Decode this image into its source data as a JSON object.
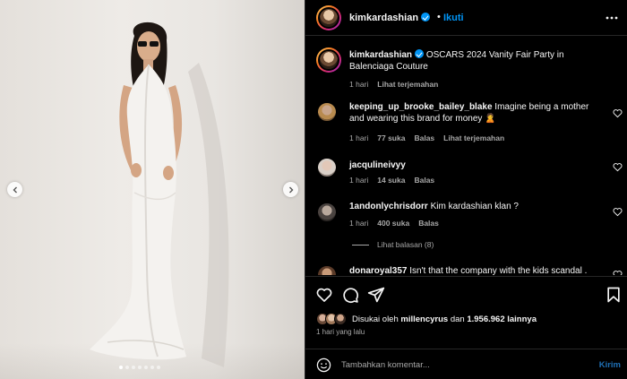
{
  "post": {
    "username": "kimkardashian",
    "verified": true,
    "separator": "•",
    "follow_label": "Ikuti",
    "caption": "OSCARS 2024 Vanity Fair Party in Balenciaga Couture",
    "caption_time": "1 hari",
    "caption_translate": "Lihat terjemahan",
    "photo_alt": "Kim Kardashian in a white Balenciaga halter gown",
    "carousel_dots": 7,
    "carousel_active": 0
  },
  "comments": [
    {
      "username": "keeping_up_brooke_bailey_blake",
      "text": "Imagine being a mother and wearing this brand for money 🙎",
      "time": "1 hari",
      "likes": "77 suka",
      "reply": "Balas",
      "translate": "Lihat terjemahan"
    },
    {
      "username": "jacqulineivyy",
      "text": "",
      "time": "1 hari",
      "likes": "14 suka",
      "reply": "Balas"
    },
    {
      "username": "1andonlychrisdorr",
      "text": "Kim kardashian klan ?",
      "time": "1 hari",
      "likes": "400 suka",
      "reply": "Balas",
      "view_replies": "Lihat balasan (8)"
    },
    {
      "username": "donaroyal357",
      "text": "Isn't that the company with the kids scandal .",
      "time": "",
      "likes": "",
      "reply": ""
    }
  ],
  "likes_summary": {
    "prefix": "Disukai oleh",
    "user": "millencyrus",
    "middle": "dan",
    "count": "1.956.962",
    "suffix": "lainnya"
  },
  "post_age": "1 hari yang lalu",
  "comment_box": {
    "placeholder": "Tambahkan komentar...",
    "send_label": "Kirim"
  },
  "colors": {
    "background": "#000000",
    "text": "#f5f5f5",
    "secondary_text": "#a8a8a8",
    "link_blue": "#0095f6",
    "divider": "#262626"
  },
  "icons": [
    "more-icon",
    "like-icon",
    "comment-icon",
    "share-icon",
    "save-icon",
    "emoji-icon",
    "heart-small-icon",
    "chevron-left-icon",
    "chevron-right-icon",
    "verified-icon"
  ]
}
